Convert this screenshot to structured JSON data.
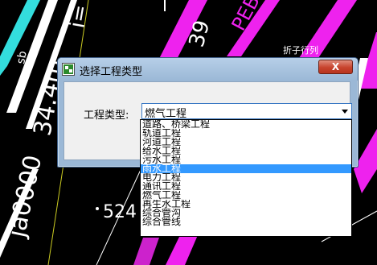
{
  "background": {
    "texts": [
      "34.4m",
      "i=",
      "39",
      "PEB",
      "524",
      "ja0000",
      "sb"
    ],
    "handwritten_note": "折子行列"
  },
  "dialog": {
    "title": "选择工程类型",
    "close_label": "X",
    "field_label": "工程类型:",
    "selected_value": "燃气工程",
    "options": [
      "道路、桥梁工程",
      "轨道工程",
      "河道工程",
      "给水工程",
      "污水工程",
      "雨水工程",
      "电力工程",
      "通讯工程",
      "燃气工程",
      "再生水工程",
      "综合管沟",
      "综合管线"
    ],
    "highlighted_option": "雨水工程"
  },
  "colors": {
    "title_bar": "#9bb8d6",
    "close_button": "#c7432e",
    "highlight": "#3399ff",
    "cad_magenta": "#ee22ee",
    "cad_cyan": "#33dddd"
  }
}
